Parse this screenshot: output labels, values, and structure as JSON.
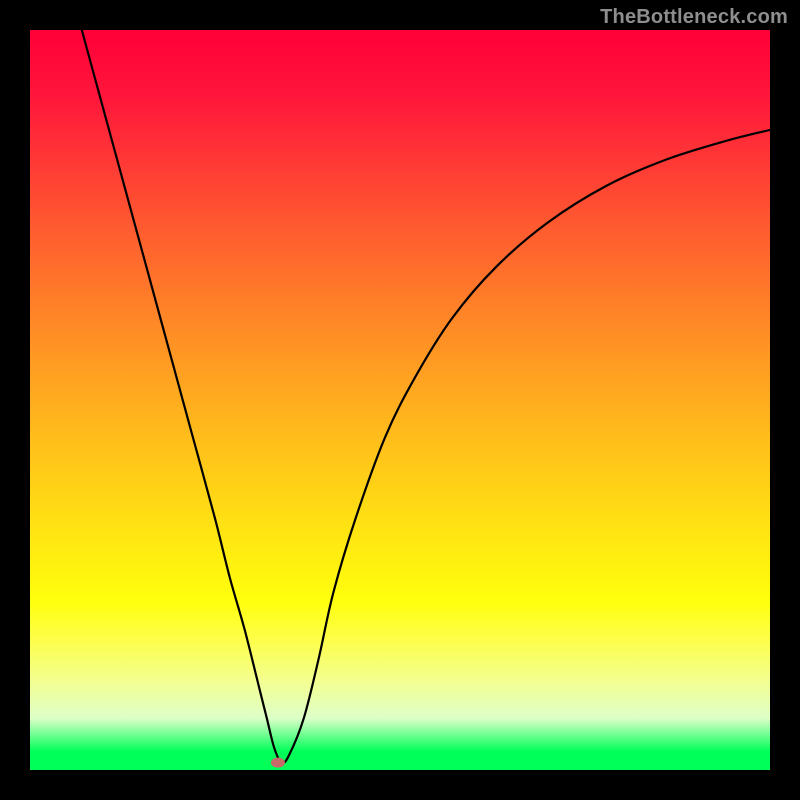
{
  "attribution_text": "TheBottleneck.com",
  "chart_data": {
    "type": "line",
    "title": "",
    "xlabel": "",
    "ylabel": "",
    "xlim": [
      0,
      100
    ],
    "ylim": [
      0,
      100
    ],
    "background_gradient": {
      "top": "#ff0038",
      "mid": "#ffff0c",
      "bottom": "#00ff59"
    },
    "series": [
      {
        "name": "bottleneck-curve",
        "color": "#000000",
        "x": [
          7,
          10,
          13,
          16,
          19,
          22,
          25,
          27,
          29,
          31,
          32,
          33,
          34,
          35,
          37,
          39,
          41,
          44,
          48,
          52,
          57,
          63,
          70,
          78,
          86,
          94,
          100
        ],
        "y": [
          100,
          89,
          78,
          67,
          56,
          45,
          34,
          26,
          19,
          11,
          7,
          3,
          1,
          2,
          7,
          15,
          24,
          34,
          45,
          53,
          61,
          68,
          74,
          79,
          82.5,
          85,
          86.5
        ]
      }
    ],
    "marker": {
      "x": 33.5,
      "y": 1,
      "color": "#c76a6a"
    }
  }
}
